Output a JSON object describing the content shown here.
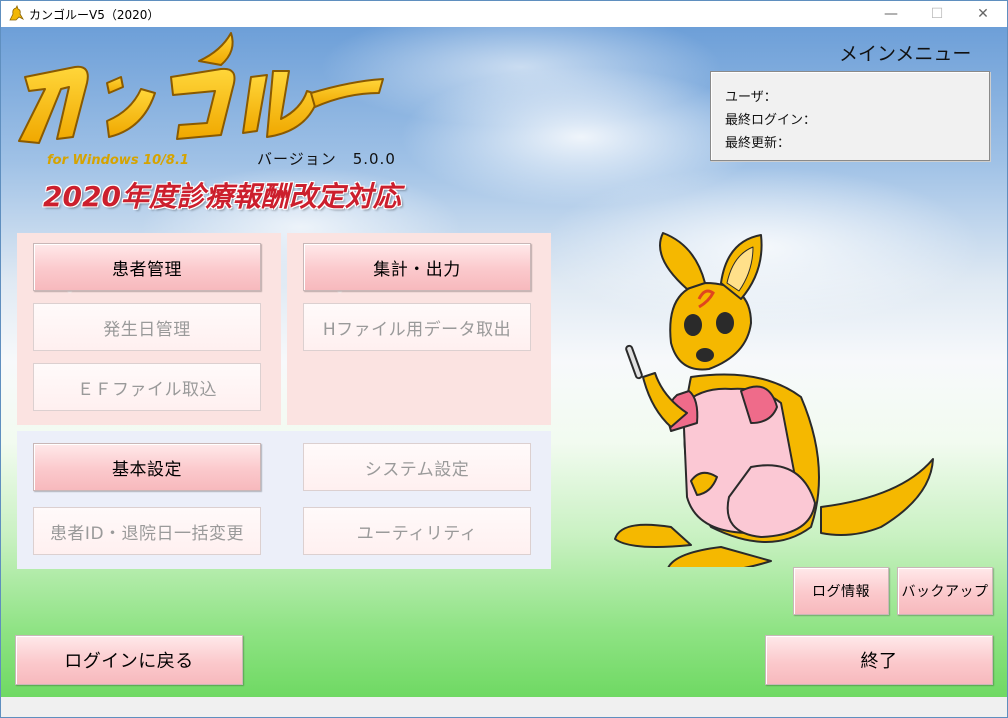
{
  "window": {
    "title": "カンゴルーV5（2020）",
    "minimize": "—",
    "maximize": "☐",
    "close": "✕"
  },
  "logo": {
    "brand": "カンゴルー",
    "sub": "for Windows 10/8.1"
  },
  "version_label": "バージョン　5.0.0",
  "revision_banner": "2020年度診療報酬改定対応",
  "menu_title": "メインメニュー",
  "user_info": {
    "user": "ユーザ：",
    "last_login": "最終ログイン：",
    "last_update": "最終更新："
  },
  "buttons": {
    "patient_mgmt": "患者管理",
    "onset_mgmt": "発生日管理",
    "ef_import": "ＥＦファイル取込",
    "aggregate_output": "集計・出力",
    "h_file_data": "Hファイル用データ取出",
    "basic_settings": "基本設定",
    "system_settings": "システム設定",
    "patient_id_bulk": "患者ID・退院日一括変更",
    "utility": "ユーティリティ",
    "log_info": "ログ情報",
    "backup": "バックアップ",
    "back_to_login": "ログインに戻る",
    "exit": "終了"
  },
  "colors": {
    "accent": "#cc1f2d",
    "logo_gold": "#f2b705",
    "button_pink": "#f9c3c7"
  }
}
